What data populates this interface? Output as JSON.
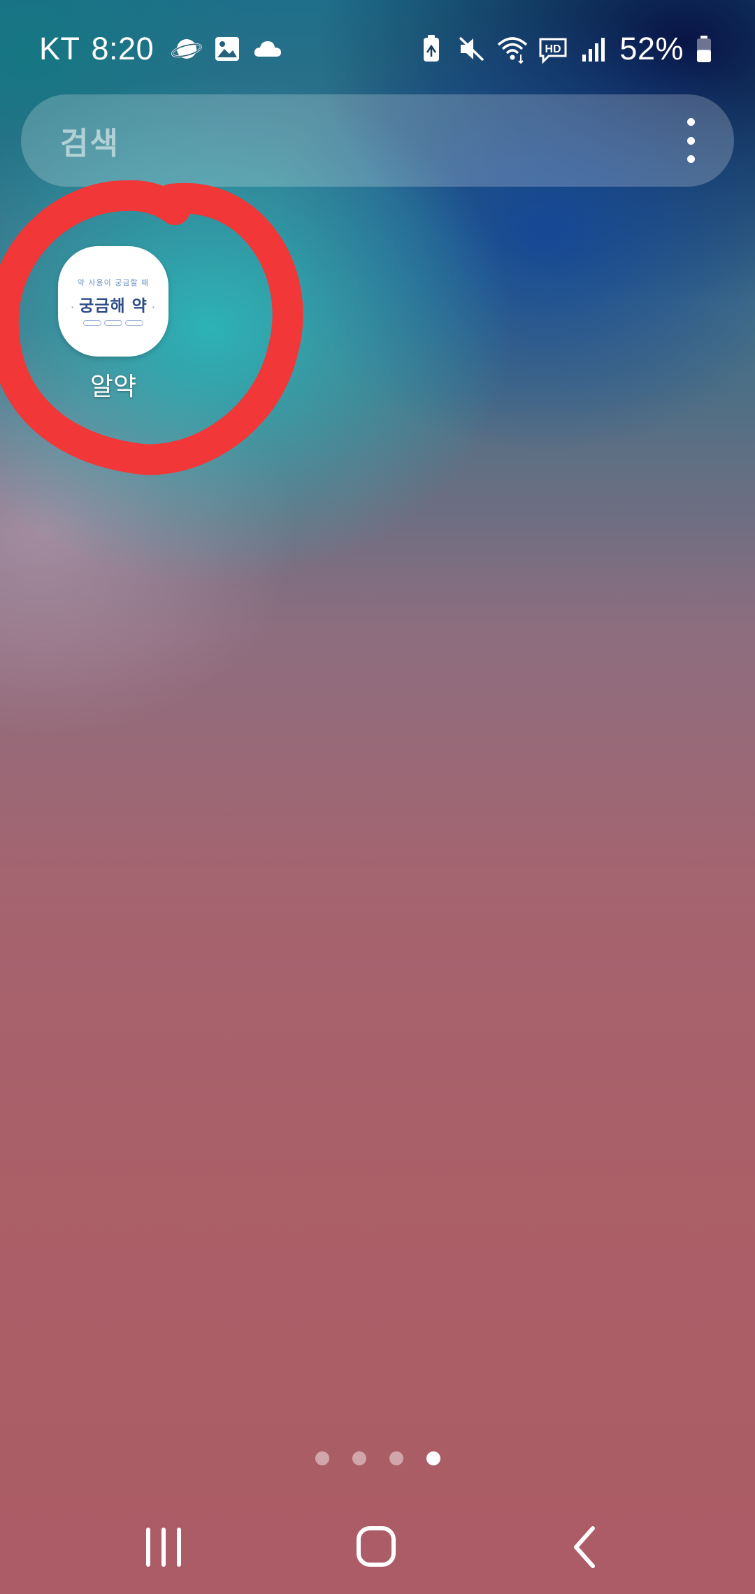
{
  "status_bar": {
    "carrier": "KT",
    "time": "8:20",
    "battery_percent": "52%",
    "battery_level": 0.52,
    "left_icons": [
      "planet-icon",
      "gallery-icon",
      "cloud-icon"
    ],
    "right_icons": [
      "battery-saver-icon",
      "mute-icon",
      "wifi-icon",
      "hd-voice-icon",
      "signal-icon",
      "battery-icon"
    ],
    "hd_label": "HD"
  },
  "search_bar": {
    "placeholder": "검색",
    "menu_icon": "more-vertical-icon"
  },
  "app_shortcut": {
    "label": "알약",
    "icon_title": "궁금해 약",
    "icon_tagline": "약 사용이 궁금할 때"
  },
  "annotation": {
    "shape": "circle",
    "color": "#f13737"
  },
  "page_indicator": {
    "count": 4,
    "active_index": 3
  },
  "nav_bar": {
    "buttons": [
      "recent-apps-icon",
      "home-icon",
      "back-icon"
    ]
  },
  "colors": {
    "annotation_red": "#f13737",
    "text_white": "#ffffff"
  }
}
